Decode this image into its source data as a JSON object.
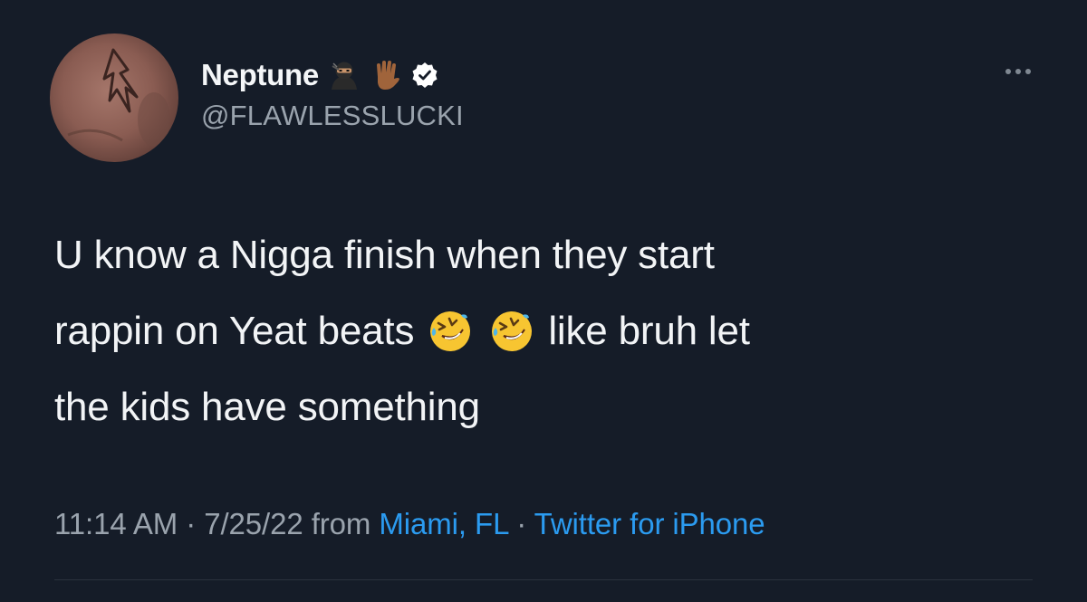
{
  "tweet": {
    "display_name": "Neptune",
    "handle": "@FLAWLESSLUCKI",
    "name_icons": [
      "ninja-emoji",
      "vulcan-salute-emoji",
      "verified-badge-icon"
    ],
    "text_line1": "U know a Nigga finish when they start",
    "text_line2_before": "rappin on Yeat beats",
    "text_line2_after": "like bruh let",
    "text_line3": "the kids have something",
    "inline_emoji": [
      "rofl-emoji",
      "rofl-emoji"
    ],
    "time": "11:14 AM",
    "separator": "·",
    "date": "7/25/22",
    "from_label": "from",
    "location": "Miami, FL",
    "client": "Twitter for iPhone"
  },
  "colors": {
    "background": "#151c28",
    "text": "#f2f4f6",
    "secondary": "#9aa3ad",
    "link": "#2b9bf0"
  }
}
